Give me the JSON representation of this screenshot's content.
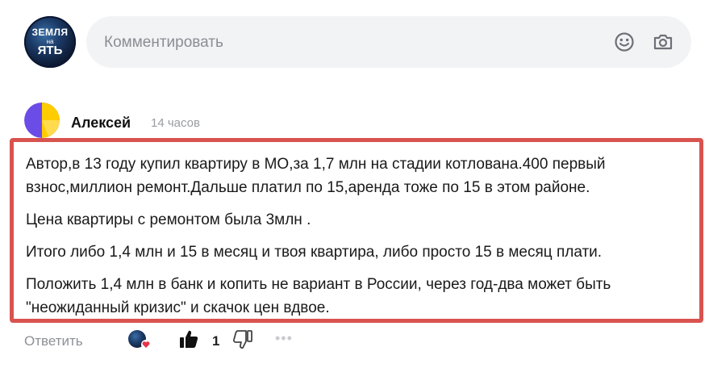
{
  "composer": {
    "brand_avatar": {
      "line1": "ЗЕМЛЯ",
      "line2": "на",
      "line3": "ЯТЬ"
    },
    "placeholder": "Комментировать",
    "icons": {
      "emoji": "smile-icon",
      "photo": "camera-icon"
    }
  },
  "comment": {
    "author": "Алексей",
    "time": "14 часов",
    "paragraphs": [
      "Автор,в 13 году купил квартиру в МО,за 1,7 млн на стадии котлована.400 первый взнос,миллион ремонт.Дальше платил по 15,аренда тоже по 15 в этом районе.",
      "Цена квартиры с ремонтом была 3млн .",
      "Итого либо 1,4 млн и 15 в месяц и твоя квартира, либо просто 15 в месяц плати.",
      "Положить 1,4 млн в банк и копить не вариант в России, через год-два может быть \"неожиданный кризис\" и скачок цен вдвое."
    ],
    "highlight_color": "#d9534f"
  },
  "actions": {
    "reply_label": "Ответить",
    "like_count": "1",
    "liked_by": "ЗЕМЛЯ на ЯТЬ"
  }
}
